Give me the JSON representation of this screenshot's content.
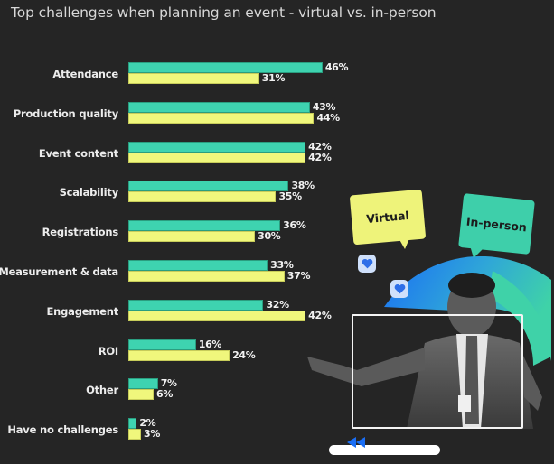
{
  "chart_data": {
    "type": "bar",
    "orientation": "horizontal",
    "title": "Top challenges when planning an event - virtual vs. in-person",
    "xlabel": "",
    "ylabel": "",
    "xlim": [
      0,
      100
    ],
    "grid": false,
    "value_suffix": "%",
    "categories": [
      "Attendance",
      "Production quality",
      "Event content",
      "Scalability",
      "Registrations",
      "Measurement & data",
      "Engagement",
      "ROI",
      "Other",
      "Have no challenges"
    ],
    "series": [
      {
        "name": "Virtual",
        "color": "#3ed3b0",
        "values": [
          46,
          43,
          42,
          38,
          36,
          33,
          32,
          16,
          7,
          2
        ]
      },
      {
        "name": "In-person",
        "color": "#f0f77c",
        "values": [
          31,
          44,
          42,
          35,
          30,
          37,
          42,
          24,
          6,
          3
        ]
      }
    ],
    "legend": {
      "placement": "right (speech bubbles)",
      "entries": [
        {
          "label": "Virtual",
          "color": "#eef37a"
        },
        {
          "label": "In-person",
          "color": "#3ecfaa"
        }
      ]
    }
  },
  "illustration": {
    "bubble_virtual": "Virtual",
    "bubble_inperson": "In-person",
    "icons": [
      "heart-icon",
      "heart-icon",
      "rewind-icon"
    ],
    "colors": {
      "background": "#252525",
      "arc_gradient_start": "#1a6ef5",
      "arc_gradient_end": "#3fd2a8",
      "heart": "#2d6ee8"
    }
  }
}
